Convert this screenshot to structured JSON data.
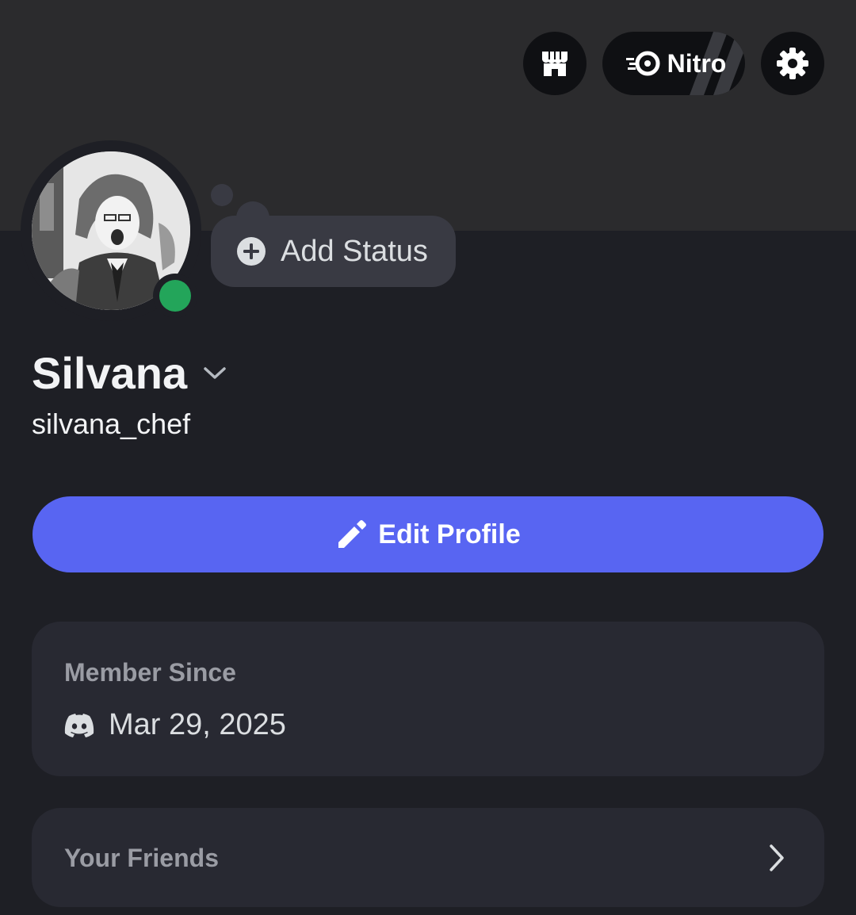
{
  "header": {
    "shop_icon": "shop-icon",
    "nitro_label": "Nitro",
    "nitro_icon": "nitro-icon",
    "settings_icon": "gear-icon"
  },
  "profile": {
    "display_name": "Silvana",
    "username": "silvana_chef",
    "status_color": "#23a55a",
    "add_status_label": "Add Status"
  },
  "actions": {
    "edit_profile_label": "Edit Profile"
  },
  "member_since": {
    "title": "Member Since",
    "date": "Mar 29, 2025",
    "icon": "discord-icon"
  },
  "friends": {
    "title": "Your Friends"
  },
  "colors": {
    "accent": "#5865f2",
    "background": "#1e1f25",
    "banner": "#2b2b2d",
    "card": "#282932"
  }
}
